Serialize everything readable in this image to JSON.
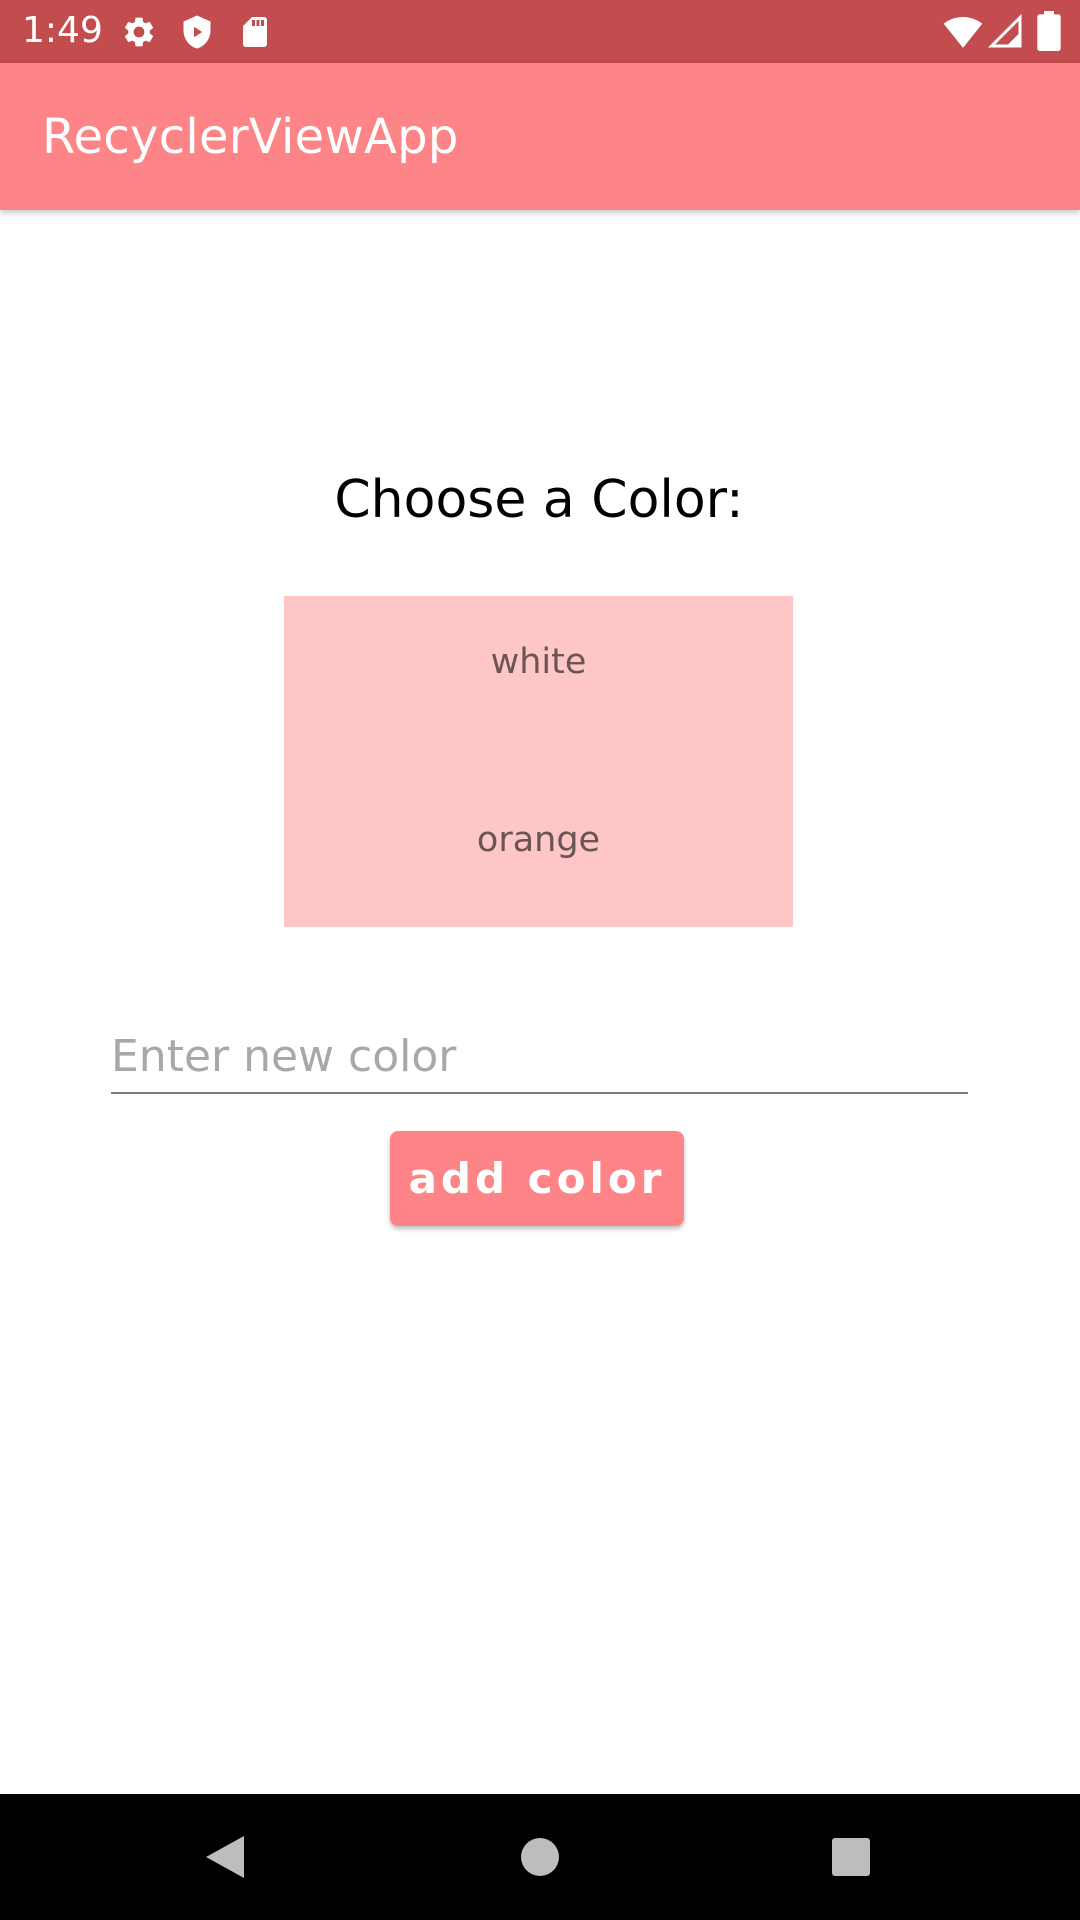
{
  "status_bar": {
    "time": "1:49",
    "background": "#c34c4e",
    "icons": [
      "settings-icon",
      "shield-icon",
      "sd-card-icon",
      "wifi-icon",
      "signal-icon",
      "battery-icon"
    ]
  },
  "app_bar": {
    "title": "RecyclerViewApp",
    "background": "#fd8587"
  },
  "main": {
    "prompt": "Choose a Color:",
    "color_list": {
      "background": "#fec6c6",
      "items": [
        "white",
        "orange"
      ]
    },
    "new_color_input": {
      "value": "",
      "placeholder": "Enter new color"
    },
    "add_button_label": "add color"
  },
  "nav_bar": {
    "icons": [
      "back-icon",
      "home-icon",
      "recents-icon"
    ]
  }
}
